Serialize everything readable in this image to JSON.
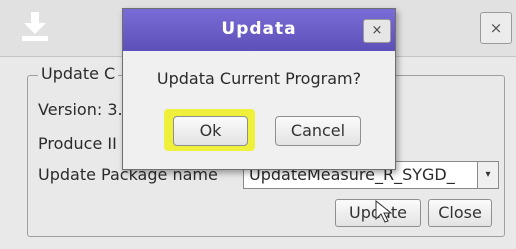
{
  "main_window": {
    "close_glyph": "×",
    "icon": "download-icon",
    "group_title": "Update C",
    "version_label": "Version: 3.",
    "produce_label": "Produce II",
    "package_label": "Update Package name",
    "package_value": "UpdateMeasure_R_SYGD_",
    "update_button": "Update",
    "close_button": "Close"
  },
  "dialog": {
    "title": "Updata",
    "close_glyph": "×",
    "message": "Updata Current Program?",
    "ok_button": "Ok",
    "cancel_button": "Cancel"
  },
  "colors": {
    "dialog_titlebar": "#6a5dc8",
    "ok_highlight": "#eef03c"
  }
}
